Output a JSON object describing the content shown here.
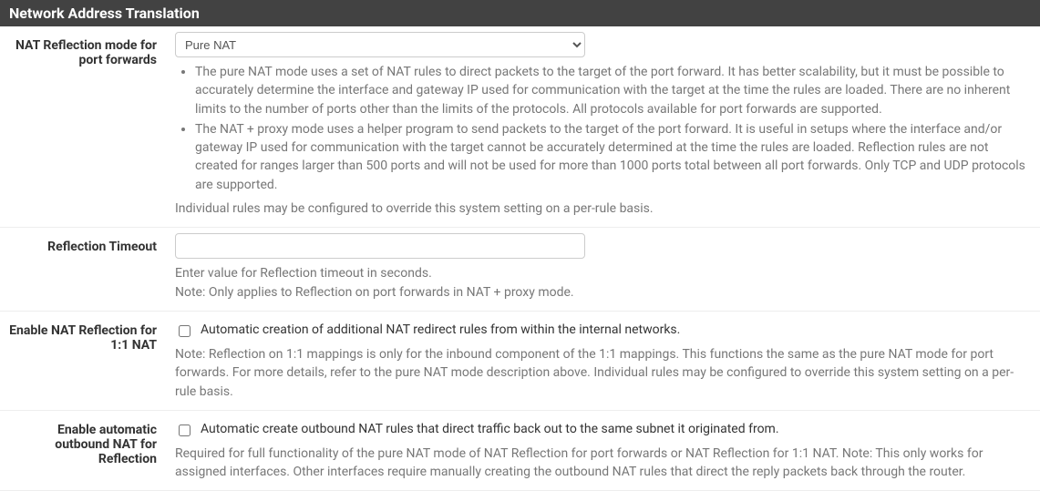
{
  "panel": {
    "title": "Network Address Translation"
  },
  "fields": {
    "reflection_mode": {
      "label": "NAT Reflection mode for port forwards",
      "selected": "Pure NAT",
      "bullet1": "The pure NAT mode uses a set of NAT rules to direct packets to the target of the port forward. It has better scalability, but it must be possible to accurately determine the interface and gateway IP used for communication with the target at the time the rules are loaded. There are no inherent limits to the number of ports other than the limits of the protocols. All protocols available for port forwards are supported.",
      "bullet2": "The NAT + proxy mode uses a helper program to send packets to the target of the port forward. It is useful in setups where the interface and/or gateway IP used for communication with the target cannot be accurately determined at the time the rules are loaded. Reflection rules are not created for ranges larger than 500 ports and will not be used for more than 1000 ports total between all port forwards. Only TCP and UDP protocols are supported.",
      "note": "Individual rules may be configured to override this system setting on a per-rule basis."
    },
    "reflection_timeout": {
      "label": "Reflection Timeout",
      "value": "",
      "help1": "Enter value for Reflection timeout in seconds.",
      "help2": "Note: Only applies to Reflection on port forwards in NAT + proxy mode."
    },
    "enable_1to1": {
      "label": "Enable NAT Reflection for 1:1 NAT",
      "checkbox_label": "Automatic creation of additional NAT redirect rules from within the internal networks.",
      "help": "Note: Reflection on 1:1 mappings is only for the inbound component of the 1:1 mappings. This functions the same as the pure NAT mode for port forwards. For more details, refer to the pure NAT mode description above. Individual rules may be configured to override this system setting on a per-rule basis."
    },
    "enable_auto_outbound": {
      "label": "Enable automatic outbound NAT for Reflection",
      "checkbox_label": "Automatic create outbound NAT rules that direct traffic back out to the same subnet it originated from.",
      "help": "Required for full functionality of the pure NAT mode of NAT Reflection for port forwards or NAT Reflection for 1:1 NAT. Note: This only works for assigned interfaces. Other interfaces require manually creating the outbound NAT rules that direct the reply packets back through the router."
    }
  }
}
